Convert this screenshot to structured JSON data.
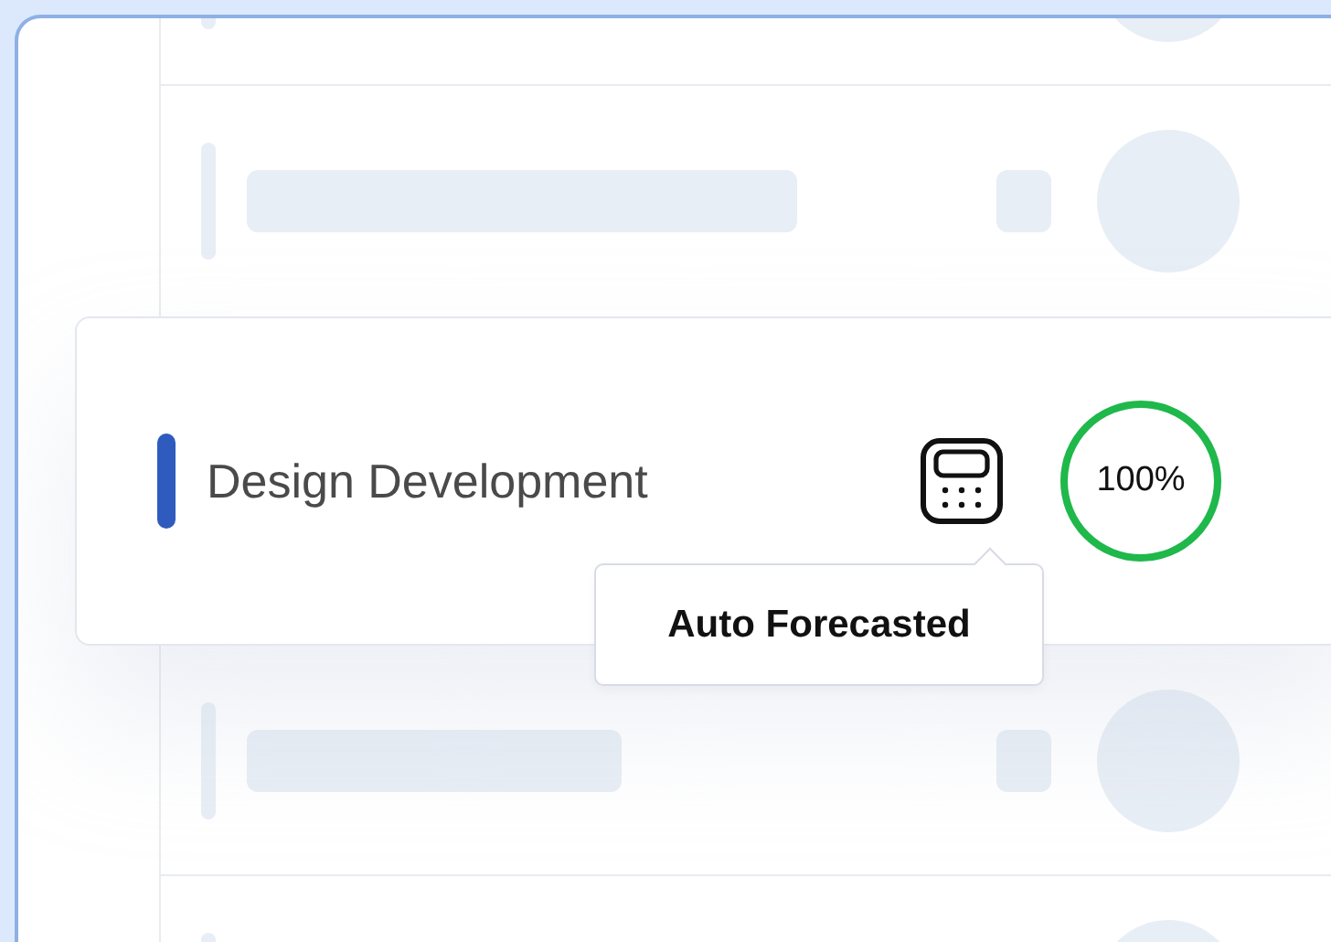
{
  "task": {
    "name": "Design Development",
    "percent": "100%",
    "level": 1
  },
  "tooltip": {
    "text": "Auto Forecasted"
  }
}
